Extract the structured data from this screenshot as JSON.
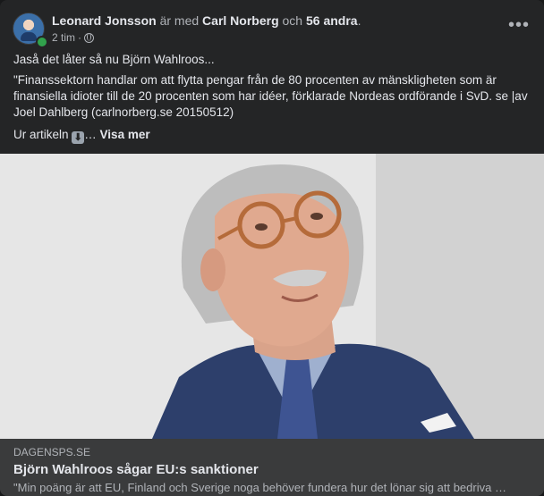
{
  "post": {
    "author": "Leonard Jonsson",
    "with_word": "är med",
    "tagged": "Carl Norberg",
    "and_word": "och",
    "others": "56 andra",
    "period": ".",
    "time": "2 tim",
    "separator": "·",
    "privacy_icon": "globe-icon",
    "more_icon": "ellipsis-icon",
    "more_label": "•••",
    "text_line1": "Jaså det låter så nu Björn Wahlroos...",
    "text_quote": "\"Finanssektorn handlar om att flytta pengar från de 80 procenten av mänskligheten som är finansiella idioter till de 20 procenten som har idéer, förklarade Nordeas ordförande i SvD. se |av Joel Dahlberg (carlnorberg.se 20150512)",
    "text_article": "Ur artikeln",
    "arrow_icon": "down-arrow-emoji-icon",
    "arrow_glyph": "⬇",
    "ellipsis": "…",
    "see_more": "Visa mer"
  },
  "link": {
    "domain": "DAGENSPS.SE",
    "title": "Björn Wahlroos sågar EU:s sanktioner",
    "description": "\"Min poäng är att EU, Finland och Sverige noga behöver fundera hur det lönar sig att bedriva …"
  },
  "colors": {
    "card": "#242526",
    "link_box": "#3a3b3c",
    "text": "#e4e6eb",
    "muted": "#b0b3b8",
    "online": "#31a24c"
  }
}
